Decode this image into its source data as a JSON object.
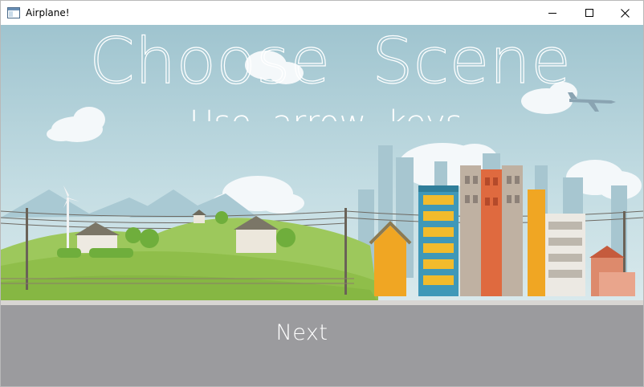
{
  "window": {
    "title": "Airplane!",
    "controls": {
      "minimize": "minimize-icon",
      "maximize": "maximize-icon",
      "close": "close-icon"
    }
  },
  "menu": {
    "heading": "Choose  Scene",
    "subheading": "Use  arrow  keys",
    "next_label": "Next"
  },
  "scene": {
    "name": "city-countryside",
    "colors": {
      "sky": "#b8d6de",
      "hills": "#8fc04a",
      "road": "#9b9b9e",
      "text": "#ffffff"
    }
  }
}
